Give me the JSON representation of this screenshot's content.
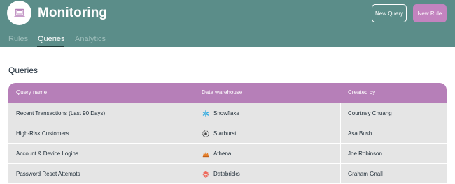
{
  "app": {
    "title": "Monitoring"
  },
  "toolbar": {
    "new_query_label": "New Query",
    "new_rule_label": "New Rule"
  },
  "tabs": [
    {
      "label": "Rules",
      "active": false
    },
    {
      "label": "Queries",
      "active": true
    },
    {
      "label": "Analytics",
      "active": false
    }
  ],
  "section": {
    "title": "Queries"
  },
  "table": {
    "headers": [
      "Query name",
      "Data warehouse",
      "Created by"
    ],
    "rows": [
      {
        "query_name": "Recent Transactions (Last 90 Days)",
        "warehouse": "Snowflake",
        "warehouse_icon": "snowflake-icon",
        "created_by": "Courtney Chuang"
      },
      {
        "query_name": "High-Risk Customers",
        "warehouse": "Starburst",
        "warehouse_icon": "starburst-icon",
        "created_by": "Asa Bush"
      },
      {
        "query_name": "Account & Device Logins",
        "warehouse": "Athena",
        "warehouse_icon": "athena-icon",
        "created_by": "Joe Robinson"
      },
      {
        "query_name": "Password Reset Attempts",
        "warehouse": "Databricks",
        "warehouse_icon": "databricks-icon",
        "created_by": "Graham Gnall"
      }
    ]
  },
  "colors": {
    "header_bg": "#5b8d89",
    "accent_purple": "#b67fb8",
    "row_bg": "#e5e5e5"
  }
}
